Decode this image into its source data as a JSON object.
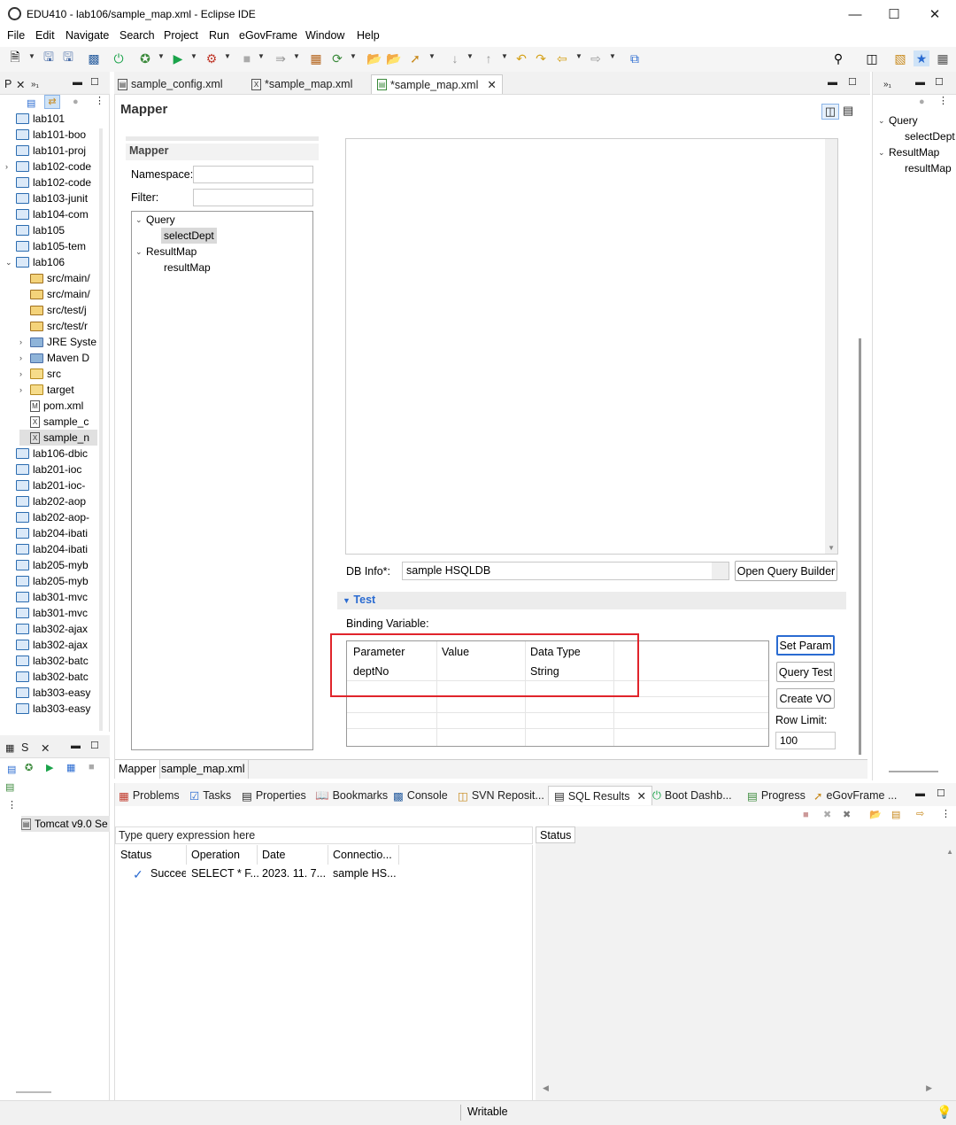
{
  "window": {
    "title": "EDU410 - lab106/sample_map.xml - Eclipse IDE"
  },
  "menu": [
    "File",
    "Edit",
    "Navigate",
    "Search",
    "Project",
    "Run",
    "eGovFrame",
    "Window",
    "Help"
  ],
  "left_panel": {
    "tab_label": "P",
    "projects": [
      {
        "label": "lab101",
        "expanded": false
      },
      {
        "label": "lab101-boo",
        "expanded": false
      },
      {
        "label": "lab101-proj",
        "expanded": false
      },
      {
        "label": "lab102-code",
        "expanded": false,
        "chev": true
      },
      {
        "label": "lab102-code",
        "expanded": false
      },
      {
        "label": "lab103-junit",
        "expanded": false
      },
      {
        "label": "lab104-com",
        "expanded": false
      },
      {
        "label": "lab105",
        "expanded": false
      },
      {
        "label": "lab105-tem",
        "expanded": false
      },
      {
        "label": "lab106",
        "expanded": true
      }
    ],
    "lab106_children": [
      {
        "label": "src/main/",
        "icon": "pkg"
      },
      {
        "label": "src/main/",
        "icon": "pkg"
      },
      {
        "label": "src/test/j",
        "icon": "pkg"
      },
      {
        "label": "src/test/r",
        "icon": "pkg"
      },
      {
        "label": "JRE Syste",
        "icon": "lib",
        "chev": true
      },
      {
        "label": "Maven D",
        "icon": "lib",
        "chev": true
      },
      {
        "label": "src",
        "icon": "folder",
        "chev": true
      },
      {
        "label": "target",
        "icon": "folder",
        "chev": true
      },
      {
        "label": "pom.xml",
        "icon": "M"
      },
      {
        "label": "sample_c",
        "icon": "X"
      },
      {
        "label": "sample_n",
        "icon": "X",
        "selected": true
      }
    ],
    "more_projects": [
      "lab106-dbic",
      "lab201-ioc",
      "lab201-ioc-",
      "lab202-aop",
      "lab202-aop-",
      "lab204-ibati",
      "lab204-ibati",
      "lab205-myb",
      "lab205-myb",
      "lab301-mvc",
      "lab301-mvc",
      "lab302-ajax",
      "lab302-ajax",
      "lab302-batc",
      "lab302-batc",
      "lab303-easy",
      "lab303-easy"
    ]
  },
  "servers_panel": {
    "tab_label": "S",
    "server": "Tomcat v9.0 Se"
  },
  "editor": {
    "tabs": [
      "sample_config.xml",
      "*sample_map.xml",
      "*sample_map.xml"
    ],
    "header": "Mapper",
    "section": "Mapper",
    "namespace_label": "Namespace:",
    "namespace_value": "",
    "filter_label": "Filter:",
    "filter_value": "",
    "tree": {
      "query_label": "Query",
      "query_child": "selectDept",
      "resultmap_label": "ResultMap",
      "resultmap_child": "resultMap"
    },
    "db_info_label": "DB Info*:",
    "db_info_value": "sample HSQLDB",
    "open_query_builder": "Open Query Builder",
    "test_section": "Test",
    "binding_label": "Binding Variable:",
    "columns": [
      "Parameter",
      "Value",
      "Data Type"
    ],
    "rows": [
      {
        "param": "deptNo",
        "value": "",
        "type": "String"
      }
    ],
    "buttons": {
      "set_param": "Set Param",
      "query_test": "Query Test",
      "create_vo": "Create VO"
    },
    "row_limit_label": "Row Limit:",
    "row_limit_value": "100",
    "bottom_tabs": [
      "Mapper",
      "sample_map.xml"
    ]
  },
  "outline": {
    "query_label": "Query",
    "query_child": "selectDept",
    "resultmap_label": "ResultMap",
    "resultmap_child": "resultMap"
  },
  "bottom_panel": {
    "tabs": [
      "Problems",
      "Tasks",
      "Properties",
      "Bookmarks",
      "Console",
      "SVN Reposit...",
      "SQL Results",
      "Boot Dashb...",
      "Progress",
      "eGovFrame ..."
    ],
    "query_placeholder": "Type query expression here",
    "columns": [
      "Status",
      "Operation",
      "Date",
      "Connectio..."
    ],
    "rows": [
      {
        "status": "Succeed",
        "operation": "SELECT * F...",
        "date": "2023. 11. 7...",
        "connection": "sample HS..."
      }
    ],
    "status_tab": "Status"
  },
  "statusbar": {
    "mode": "Writable"
  },
  "colors": {
    "highlight_red": "#e0242b",
    "accent_blue": "#2a6bd1"
  }
}
